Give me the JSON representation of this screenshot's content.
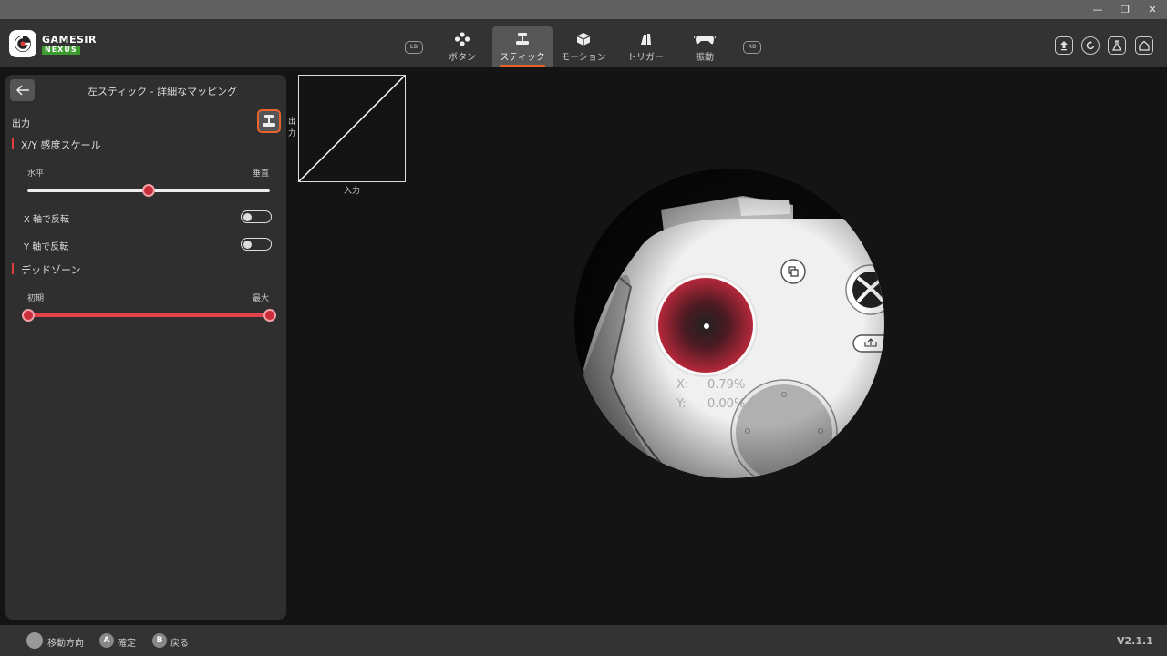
{
  "app": {
    "brand": "GAMESIR",
    "brand_sub": "NEXUS",
    "version": "V2.1.1"
  },
  "nav": {
    "lb": "LB",
    "rb": "RB",
    "tabs": [
      {
        "label": "ボタン",
        "icon": "buttons-icon"
      },
      {
        "label": "スティック",
        "icon": "stick-icon",
        "active": true
      },
      {
        "label": "モーション",
        "icon": "motion-icon"
      },
      {
        "label": "トリガー",
        "icon": "trigger-icon"
      },
      {
        "label": "振動",
        "icon": "vibration-icon"
      }
    ]
  },
  "panel": {
    "title": "左スティック - 詳細なマッピング",
    "output_label": "出力",
    "section_scale": "X/Y 感度スケール",
    "slider_left": "水平",
    "slider_right": "垂直",
    "slider_value": 0.5,
    "invert_x": "X 軸で反転",
    "invert_y": "Y 軸で反転",
    "invert_x_on": false,
    "invert_y_on": false,
    "section_deadzone": "デッドゾーン",
    "deadzone_left": "初期",
    "deadzone_right": "最大",
    "deadzone_min": 0.0,
    "deadzone_max": 1.0
  },
  "graph": {
    "y_label": "出力",
    "x_label": "入力"
  },
  "readout": {
    "x_label": "X:",
    "x_value": "0.79%",
    "y_label": "Y:",
    "y_value": "0.00%"
  },
  "footer": {
    "move": "移動方向",
    "a_key": "A",
    "confirm": "確定",
    "b_key": "B",
    "back": "戻る"
  },
  "colors": {
    "accent": "#e8642c",
    "red": "#e23b3b",
    "green": "#3b9b2f"
  }
}
